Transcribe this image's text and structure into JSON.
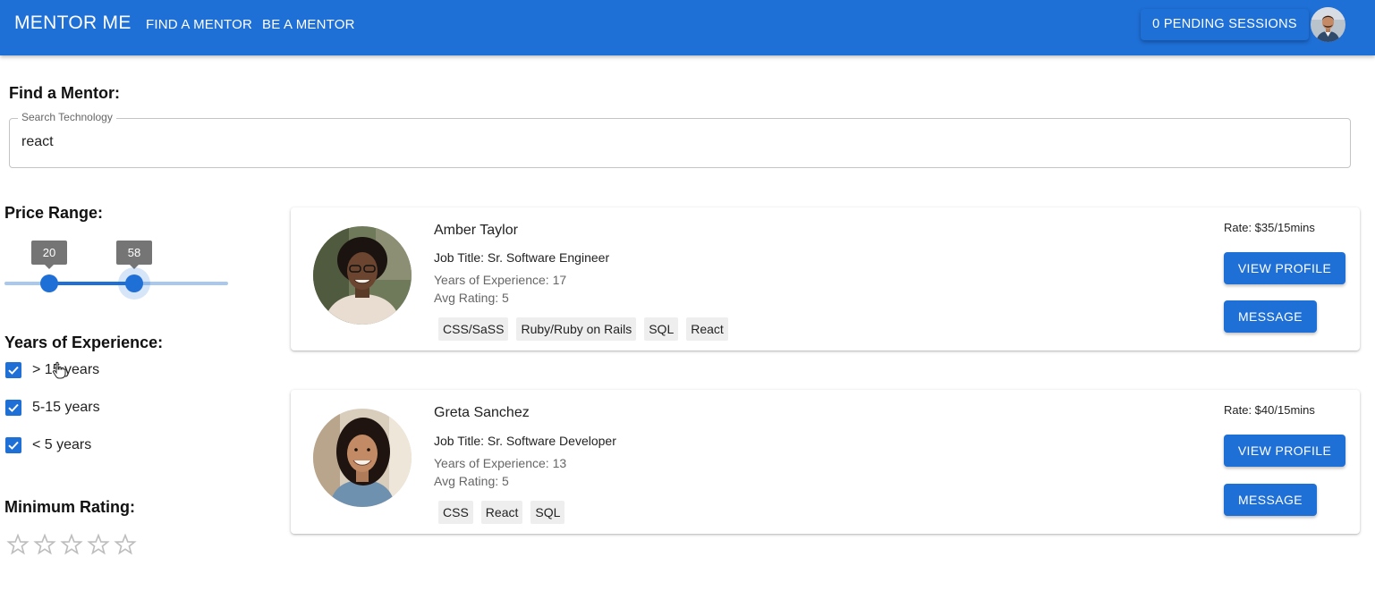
{
  "appbar": {
    "brand": "MENTOR ME",
    "nav": [
      "FIND A MENTOR",
      "BE A MENTOR"
    ],
    "pending_sessions": "0 PENDING SESSIONS",
    "accent": "#1e6fd6"
  },
  "search": {
    "title": "Find a Mentor:",
    "label": "Search Technology",
    "value": "react"
  },
  "filters": {
    "price": {
      "title": "Price Range:",
      "min": "20",
      "max": "58"
    },
    "experience": {
      "title": "Years of Experience:",
      "options": [
        {
          "label": "> 15 years",
          "checked": true
        },
        {
          "label": "5-15 years",
          "checked": true
        },
        {
          "label": "< 5 years",
          "checked": true
        }
      ]
    },
    "rating": {
      "title": "Minimum Rating:",
      "stars_filled": 0,
      "stars_total": 5
    }
  },
  "mentors": [
    {
      "name": "Amber Taylor",
      "job": "Job Title: Sr. Software Engineer",
      "experience": "Years of Experience: 17",
      "rating": "Avg Rating: 5",
      "tags": [
        "CSS/SaSS",
        "Ruby/Ruby on Rails",
        "SQL",
        "React"
      ],
      "rate": "Rate: $35/15mins",
      "view_label": "VIEW PROFILE",
      "message_label": "MESSAGE"
    },
    {
      "name": "Greta Sanchez",
      "job": "Job Title: Sr. Software Developer",
      "experience": "Years of Experience: 13",
      "rating": "Avg Rating: 5",
      "tags": [
        "CSS",
        "React",
        "SQL"
      ],
      "rate": "Rate: $40/15mins",
      "view_label": "VIEW PROFILE",
      "message_label": "MESSAGE"
    }
  ]
}
